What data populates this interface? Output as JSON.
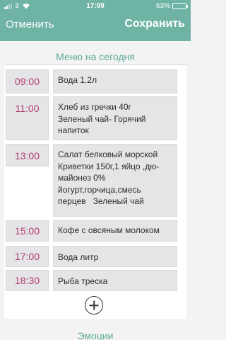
{
  "status_bar": {
    "carrier": "3",
    "time": "17:09",
    "battery": "63%",
    "battery_level": 0.63
  },
  "nav": {
    "cancel": "Отменить",
    "save": "Сохранить"
  },
  "menu": {
    "title": "Меню на сегодня",
    "items": [
      {
        "time": "09:00",
        "text": "Вода 1.2л"
      },
      {
        "time": "11:00",
        "text": "Хлеб из гречки 40г\nЗеленый чай- Горячий\nнапиток"
      },
      {
        "time": "13:00",
        "text": "Салат белковый морской\nКриветки 150г,1 яйцо ,дю-\nмайонез 0%\nйогурт,горчица,смесь\nперцев   Зеленый чай"
      },
      {
        "time": "15:00",
        "text": "Кофе с овсяным молоком"
      },
      {
        "time": "17:00",
        "text": "Вода литр"
      },
      {
        "time": "18:30",
        "text": "Рыба треска"
      }
    ]
  },
  "emotions_title": "Эмоции",
  "colors": {
    "accent": "#6fb3a4",
    "time_text": "#b13b6f"
  }
}
